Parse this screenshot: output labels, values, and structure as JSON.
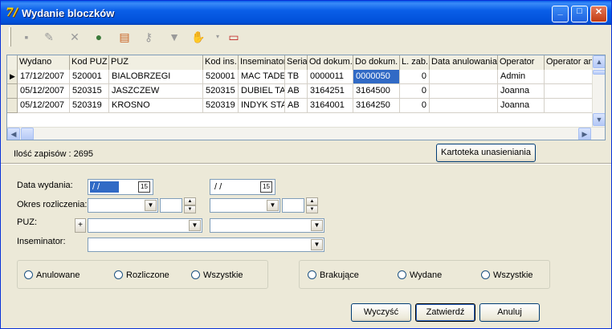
{
  "window": {
    "title": "Wydanie bloczków",
    "app_icon": "7/",
    "min": "_",
    "max": "□",
    "close": "✕"
  },
  "toolbar": {
    "icons": [
      "save-icon",
      "edit-icon",
      "delete-icon",
      "globe-icon",
      "document-icon",
      "key-icon",
      "filter-icon",
      "hand-icon",
      "dropdown-icon",
      "new-window-icon"
    ]
  },
  "grid": {
    "columns": [
      "Wydano",
      "Kod PUZ",
      "PUZ",
      "Kod ins.",
      "Inseminator",
      "Seria",
      "Od dokum.",
      "Do dokum.",
      "L. zab.",
      "Data anulowania",
      "Operator",
      "Operator an"
    ],
    "rows": [
      [
        "17/12/2007",
        "520001",
        "BIALOBRZEGI",
        "520001",
        "MAC TADE",
        "TB",
        "0000011",
        "0000050",
        "0",
        "",
        "Admin",
        ""
      ],
      [
        "05/12/2007",
        "520315",
        "JASZCZEW",
        "520315",
        "DUBIEL TA",
        "AB",
        "3164251",
        "3164500",
        "0",
        "",
        "Joanna",
        ""
      ],
      [
        "05/12/2007",
        "520319",
        "KROSNO",
        "520319",
        "INDYK STA",
        "AB",
        "3164001",
        "3164250",
        "0",
        "",
        "Joanna",
        ""
      ]
    ]
  },
  "status": {
    "count_label": "Ilość zapisów : 2695",
    "register_button": "Kartoteka unasieniania"
  },
  "filters": {
    "date_label": "Data wydania:",
    "date_from": "/ /",
    "date_to": "/ /",
    "period_label": "Okres rozliczenia:",
    "puz_label": "PUZ:",
    "puz_plus": "+",
    "inseminator_label": "Inseminator:",
    "group1": [
      "Anulowane",
      "Rozliczone",
      "Wszystkie"
    ],
    "group2": [
      "Brakujące",
      "Wydane",
      "Wszystkie"
    ]
  },
  "buttons": {
    "clear": "Wyczyść",
    "confirm": "Zatwierdź",
    "cancel": "Anuluj"
  }
}
